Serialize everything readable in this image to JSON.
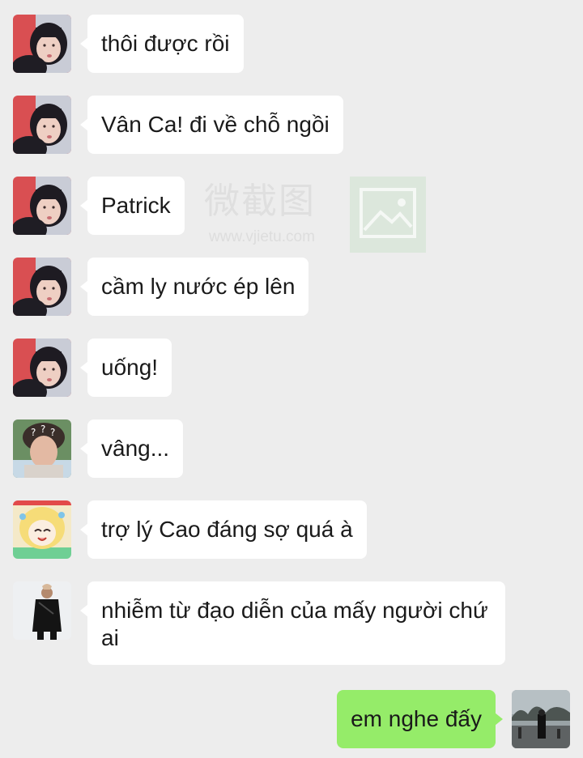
{
  "messages": [
    {
      "sender": "other",
      "avatar": "girl-avatar",
      "text": "thôi được rồi"
    },
    {
      "sender": "other",
      "avatar": "girl-avatar",
      "text": "Vân Ca! đi về chỗ ngồi"
    },
    {
      "sender": "other",
      "avatar": "girl-avatar",
      "text": "Patrick"
    },
    {
      "sender": "other",
      "avatar": "girl-avatar",
      "text": "cầm ly nước ép lên"
    },
    {
      "sender": "other",
      "avatar": "girl-avatar",
      "text": "uống!"
    },
    {
      "sender": "other",
      "avatar": "boy-question-avatar",
      "text": "vâng..."
    },
    {
      "sender": "other",
      "avatar": "anime-girl-avatar",
      "text": "trợ lý Cao đáng sợ quá à"
    },
    {
      "sender": "other",
      "avatar": "man-in-black-avatar",
      "text": "nhiễm từ đạo diễn của mấy người chứ ai"
    },
    {
      "sender": "self",
      "avatar": "street-photo-avatar",
      "text": "em nghe đấy"
    }
  ],
  "watermark": {
    "text": "微截图",
    "url": "www.vjietu.com"
  },
  "colors": {
    "background": "#ededed",
    "incoming_bubble": "#ffffff",
    "outgoing_bubble": "#95ec69"
  },
  "icons": {
    "watermark_logo": "picture-frame-icon",
    "avatar_question_marks": "?"
  }
}
